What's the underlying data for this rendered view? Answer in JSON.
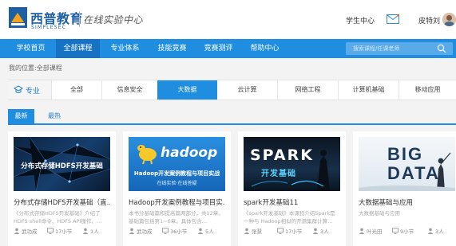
{
  "header": {
    "brand_cn": "西普教育",
    "brand_en": "SIMPLESEC",
    "brand_sub": "在线实验中心",
    "student_center": "学生中心",
    "username": "皮特刘",
    "accent": "#1f8ee0",
    "brand_color": "#1c5fa5"
  },
  "nav": {
    "items": [
      {
        "label": "学校首页",
        "active": false
      },
      {
        "label": "全部课程",
        "active": true
      },
      {
        "label": "专业体系",
        "active": false
      },
      {
        "label": "技能竞赛",
        "active": false
      },
      {
        "label": "竞赛测评",
        "active": false
      },
      {
        "label": "帮助中心",
        "active": false
      }
    ],
    "search_placeholder": "搜索课程/任课老师"
  },
  "breadcrumb": "我的位置:全部课程",
  "filter": {
    "label": "专业",
    "items": [
      {
        "label": "全部",
        "active": false
      },
      {
        "label": "信息安全",
        "active": false
      },
      {
        "label": "大数据",
        "active": true
      },
      {
        "label": "云计算",
        "active": false
      },
      {
        "label": "网络工程",
        "active": false
      },
      {
        "label": "计算机基础",
        "active": false
      },
      {
        "label": "移动应用",
        "active": false
      }
    ]
  },
  "sort_tabs": [
    {
      "label": "最新",
      "active": true
    },
    {
      "label": "最热",
      "active": false
    }
  ],
  "courses": [
    {
      "banner_text": "分布式存储HDFS开发基础",
      "title": "分布式存储HDFS开发基础（直…",
      "desc": "《分布式存储HDFS开发基础》介绍了HDFS shell命令、HDFS API操作、…",
      "author": "武功成",
      "lessons": "17小节",
      "students": "1人"
    },
    {
      "banner_text": "hadoop",
      "banner_sub": "Hadoop开发案例教程与项目实战",
      "banner_sub2": "在线实验·在线答疑",
      "title": "Hadoop开发案例教程与项目实…",
      "desc": "本书分基础篇和提高篇两部分，共12章。基础篇包括第1~6章，具体包含…",
      "author": "武功成",
      "lessons": "36小节",
      "students": "5人"
    },
    {
      "banner_text": "SPARK",
      "banner_sub": "开发基础",
      "title": "spark开发基础11",
      "desc": "《spark开发基础》本课程介绍Spark是一种与 Hadoop相似的开源集群计算…",
      "author": "张慧",
      "lessons": "17小节",
      "students": "3人"
    },
    {
      "banner_text": "BIG",
      "banner_text2": "DATA",
      "title": "大数据基础与应用",
      "desc": "大数据基础与应用",
      "author": "叶光田",
      "lessons": "9小节",
      "students": "3人"
    }
  ]
}
